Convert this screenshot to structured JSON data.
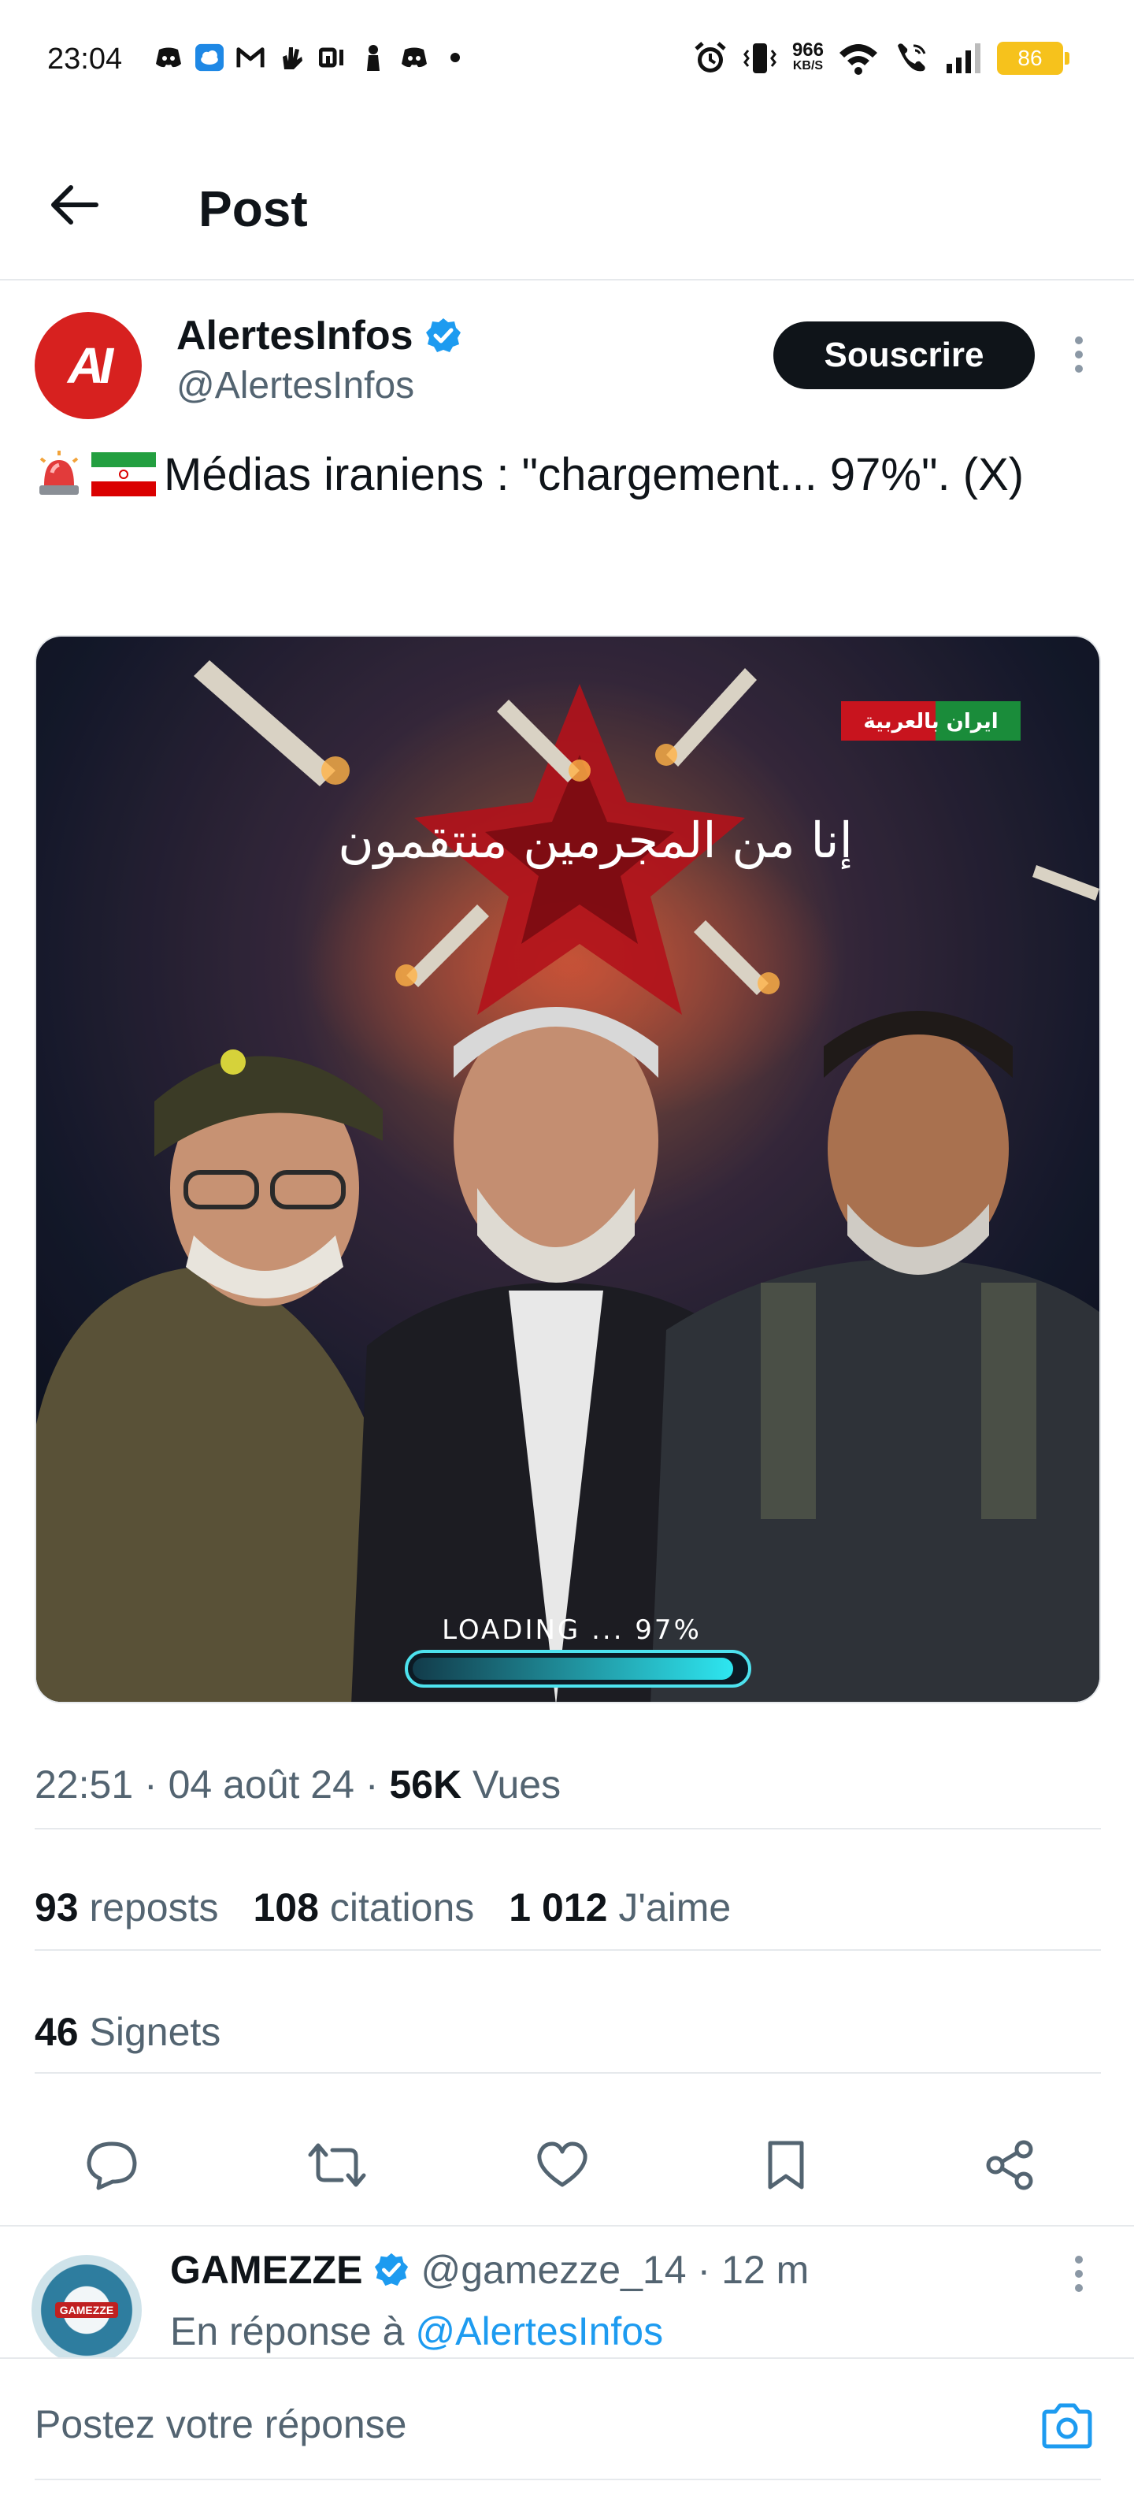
{
  "status_bar": {
    "time": "23:04",
    "speed_value": "966",
    "speed_unit": "KB/S",
    "battery": "86",
    "left_icons": [
      "discord-icon",
      "weather-icon",
      "gmail-icon",
      "hand-icon",
      "mi-icon",
      "person-icon",
      "discord-icon",
      "dot-icon"
    ],
    "right_icons": [
      "alarm-icon",
      "vibrate-icon",
      "wifi-icon",
      "wifi-call-icon",
      "signal-icon"
    ]
  },
  "header": {
    "title": "Post"
  },
  "post": {
    "author_name": "AlertesInfos",
    "author_handle": "@AlertesInfos",
    "avatar_text": "AI",
    "subscribe_label": "Souscrire",
    "text": "Médias iraniens : \"chargement... 97%\". (X)",
    "media": {
      "loading_text": "LOADING ... 97%",
      "progress": 0.97,
      "brand_text": "ايران بالعربية",
      "arabic_headline": "إنا من المجرمين منتقمون"
    },
    "time": "22:51",
    "date": "04 août 24",
    "views_count": "56K",
    "views_label": "Vues",
    "reposts_count": "93",
    "reposts_label": "reposts",
    "quotes_count": "108",
    "quotes_label": "citations",
    "likes_count": "1 012",
    "likes_label": "J'aime",
    "bookmarks_count": "46",
    "bookmarks_label": "Signets"
  },
  "reply": {
    "name": "GAMEZZE",
    "handle": "@gamezze_14",
    "age": "12 m",
    "avatar_text": "GAMEZZE",
    "in_reply_prefix": "En réponse à",
    "in_reply_handle": "@AlertesInfos"
  },
  "composer": {
    "placeholder": "Postez votre réponse"
  },
  "colors": {
    "accent": "#1d9bf0",
    "verified": "#1d9bf0",
    "battery": "#f6c21c",
    "avatar_red": "#d7211f"
  }
}
